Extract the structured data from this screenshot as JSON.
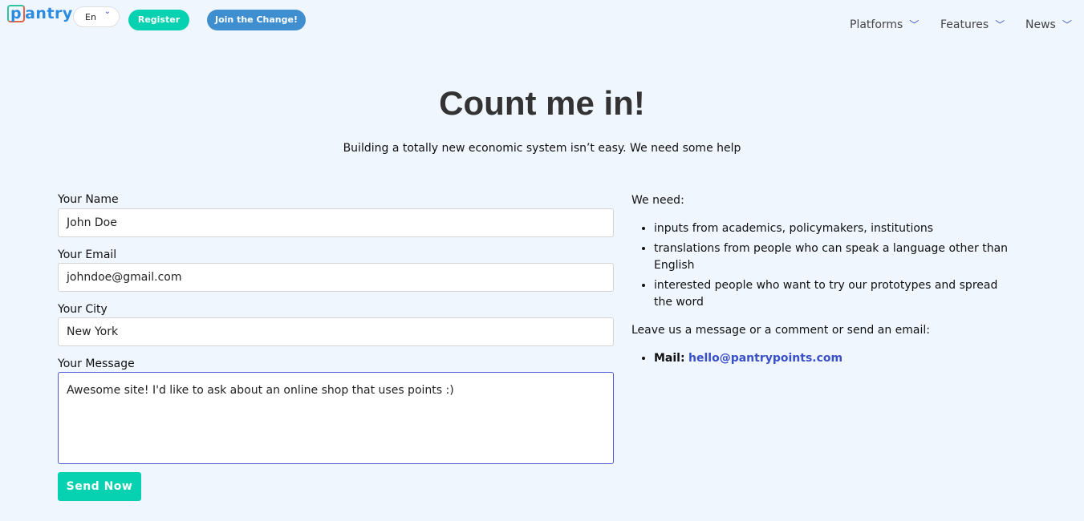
{
  "header": {
    "logo": "pantry",
    "lang": "En",
    "register": "Register",
    "join": "Join the Change!",
    "nav": [
      "Platforms",
      "Features",
      "News"
    ]
  },
  "hero": {
    "title": "Count me in!",
    "subtitle": "Building a totally new economic system isn’t easy. We need some help"
  },
  "form": {
    "name_label": "Your Name",
    "name_value": "John  Doe",
    "email_label": "Your Email",
    "email_value": "johndoe@gmail.com",
    "city_label": "Your City",
    "city_value": "New York",
    "message_label": "Your Message",
    "message_value": "Awesome site! I'd like to ask about an online shop that uses points :)",
    "send": "Send Now"
  },
  "info": {
    "need_title": "We need:",
    "needs": [
      "inputs from academics, policymakers, institutions",
      "translations from people who can speak a language other than English",
      "interested people who want to try our prototypes and spread the word"
    ],
    "leave": "Leave us a message or a comment or send an email:",
    "mail_label": "Mail:",
    "mail": "hello@pantrypoints.com"
  }
}
